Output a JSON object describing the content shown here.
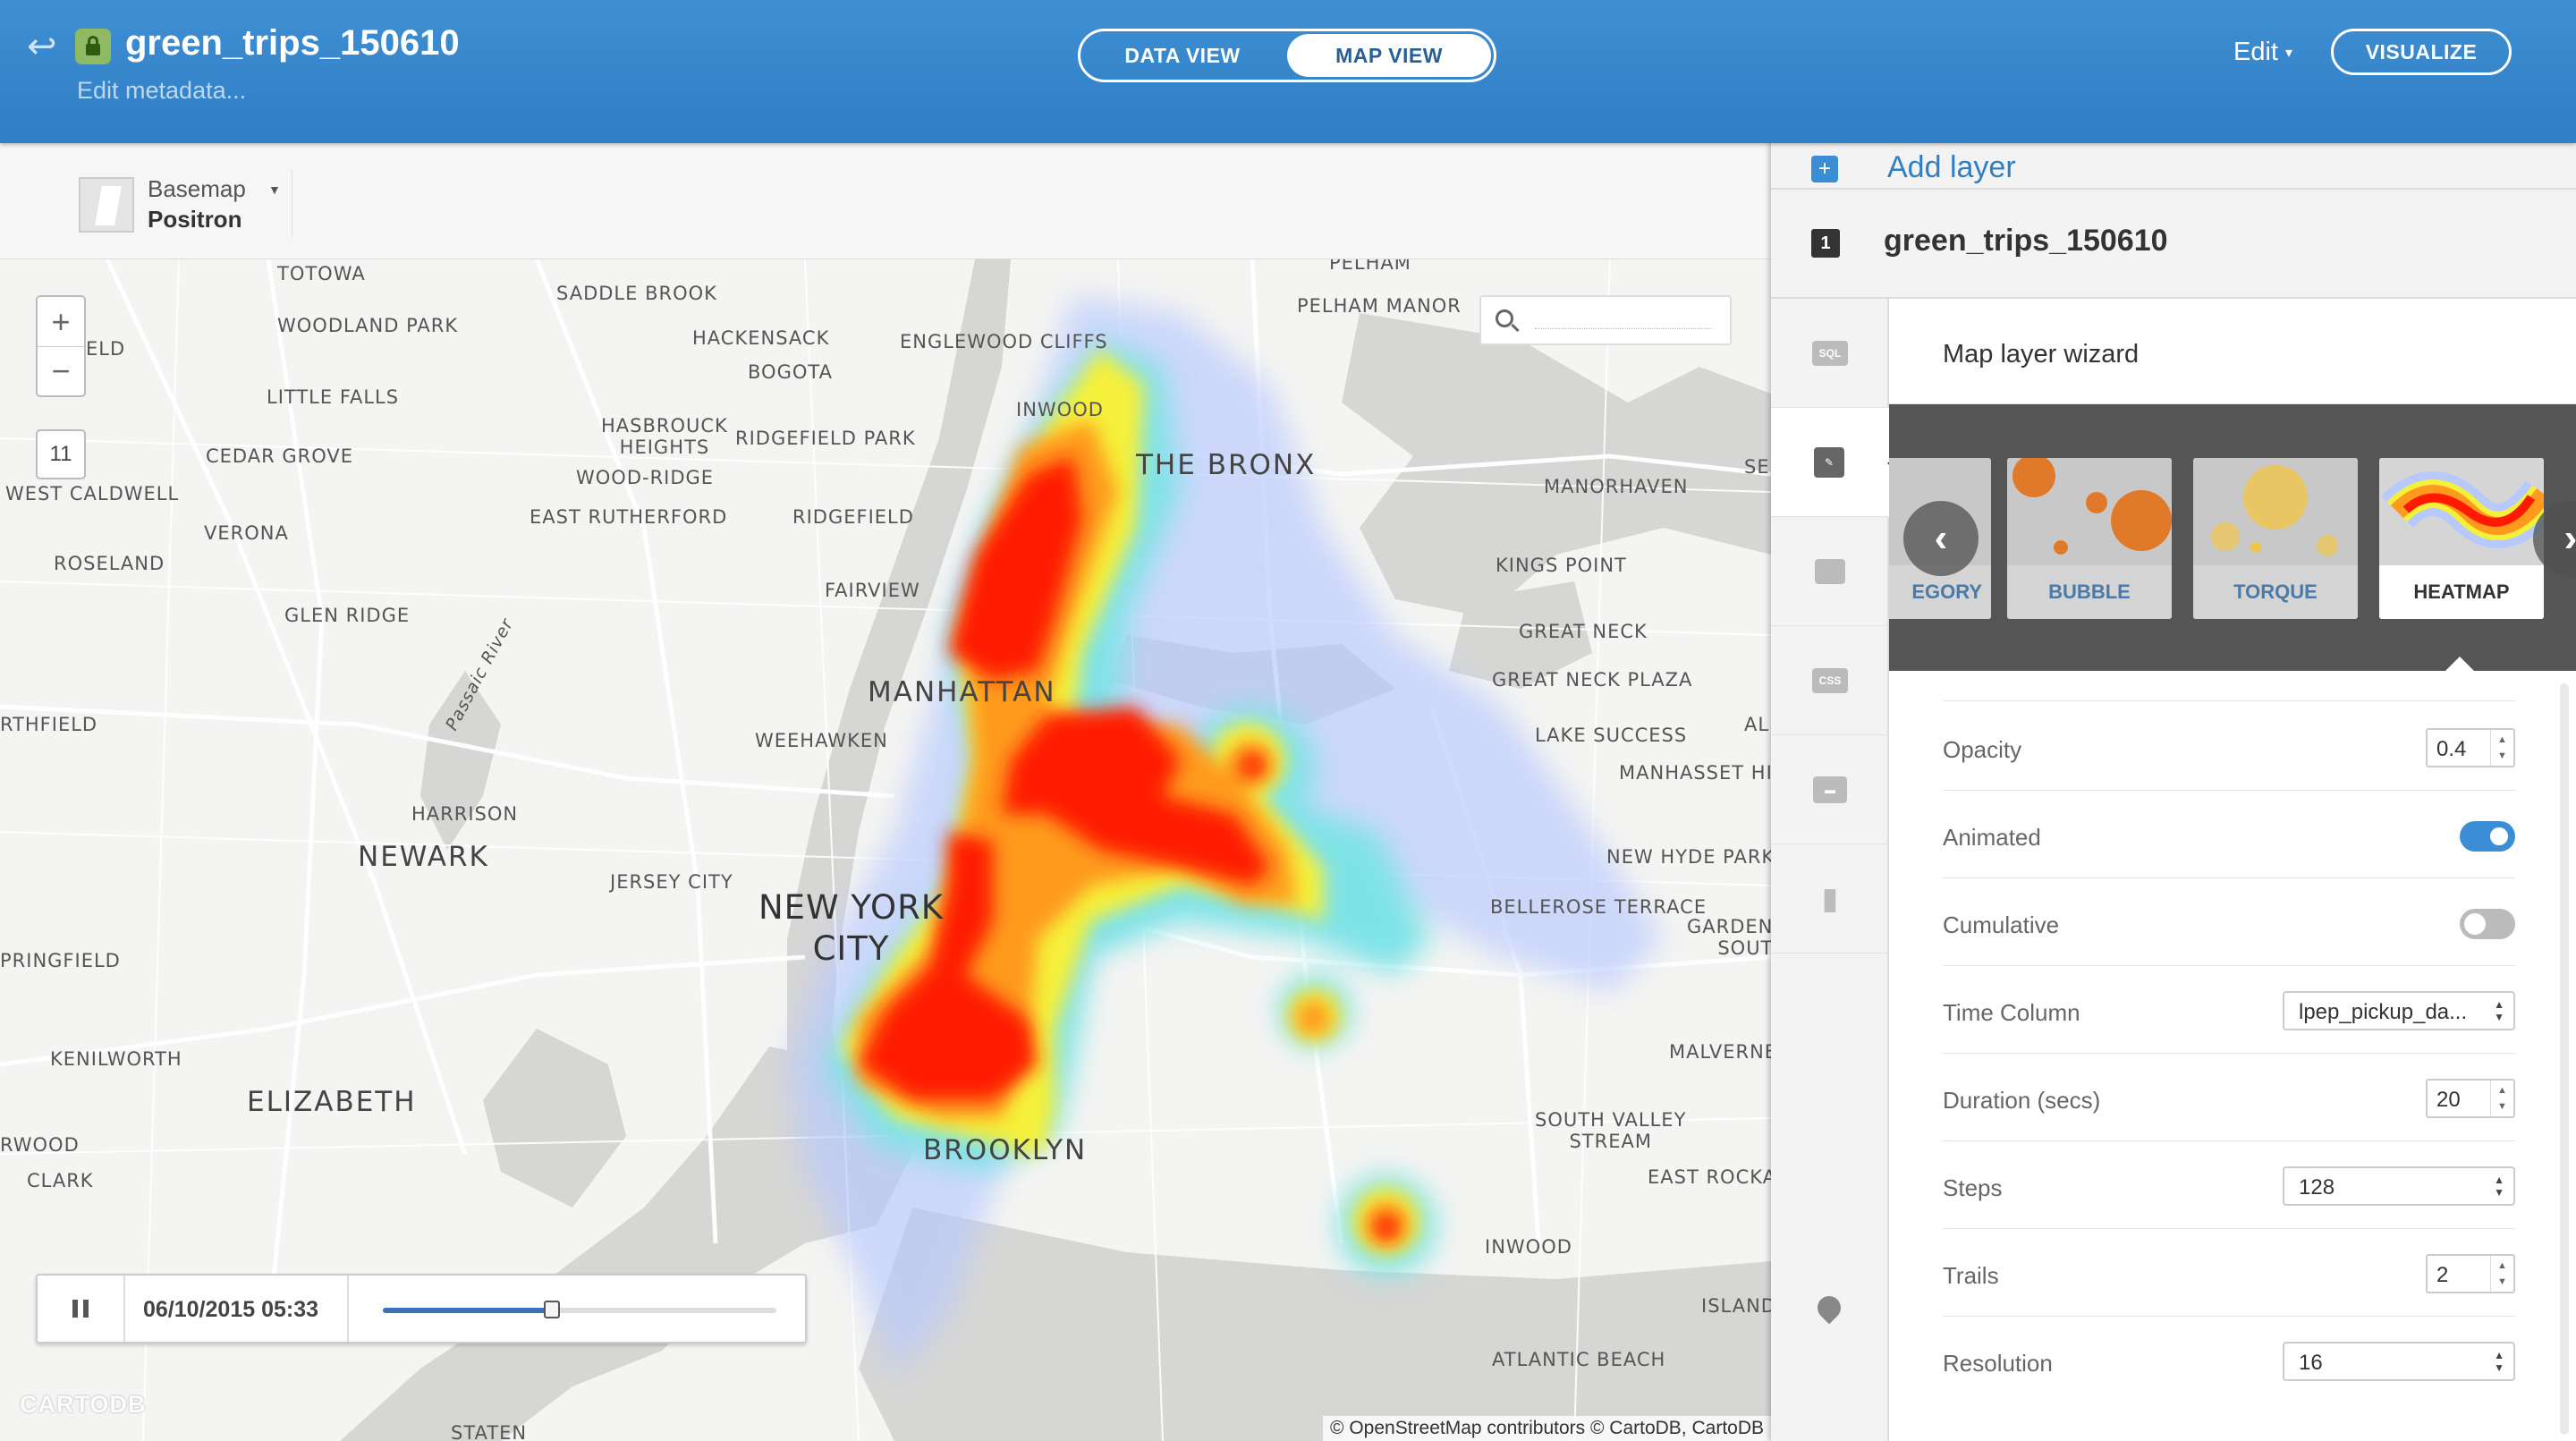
{
  "header": {
    "dataset_title": "green_trips_150610",
    "edit_metadata": "Edit metadata...",
    "tabs": [
      {
        "label": "DATA VIEW",
        "active": false
      },
      {
        "label": "MAP VIEW",
        "active": true
      }
    ],
    "edit_label": "Edit",
    "visualize_label": "VISUALIZE",
    "brand_color": "#3585cc"
  },
  "toolbar": {
    "basemap_label": "Basemap",
    "basemap_value": "Positron"
  },
  "map": {
    "zoom_in": "+",
    "zoom_out": "−",
    "zoom_level": "11",
    "search_placeholder": "",
    "attribution": "© OpenStreetMap contributors © CartoDB, CartoDB",
    "logo_text": "CARTODB",
    "places": {
      "totowa": "TOTOWA",
      "saddle_brook": "SADDLE BROOK",
      "woodland_park": "WOODLAND PARK",
      "hackensack": "HACKENSACK",
      "englewood_cliffs": "ENGLEWOOD CLIFFS",
      "pelham_manor": "PELHAM MANOR",
      "bogota": "BOGOTA",
      "inwood": "INWOOD",
      "little_falls": "LITTLE FALLS",
      "hasbrouck_heights": "HASBROUCK\nHEIGHTS",
      "ridgefield_park": "RIDGEFIELD PARK",
      "the_bronx": "THE BRONX",
      "cedar_grove": "CEDAR GROVE",
      "wood_ridge": "WOOD-RIDGE",
      "manorhaven": "MANORHAVEN",
      "west_caldwell": "WEST CALDWELL",
      "east_rutherford": "EAST RUTHERFORD",
      "ridgefield": "RIDGEFIELD",
      "verona": "VERONA",
      "roseland": "ROSELAND",
      "kings_point": "KINGS POINT",
      "fairview": "FAIRVIEW",
      "glen_ridge": "GLEN RIDGE",
      "great_neck": "GREAT NECK",
      "manhattan": "MANHATTAN",
      "great_neck_plaza": "GREAT NECK PLAZA",
      "northfield": "RTHFIELD",
      "weehawken": "WEEHAWKEN",
      "lake_success": "LAKE SUCCESS",
      "manhasset_hill": "MANHASSET HILL",
      "harrison": "HARRISON",
      "passaic_river": "Passaic River",
      "newark": "NEWARK",
      "new_hyde_park": "NEW HYDE PARK",
      "jersey_city": "JERSEY CITY",
      "new_york_city": "NEW YORK\nCITY",
      "bellerose_terrace": "BELLEROSE TERRACE",
      "garden_city_south": "GARDEN\nSOUT",
      "springfield": "PRINGFIELD",
      "kenilworth": "KENILWORTH",
      "malverne": "MALVERNE",
      "elizabeth": "ELIZABETH",
      "brooklyn": "BROOKLYN",
      "south_valley_stream": "SOUTH VALLEY\nSTREAM",
      "rahway": "RWOOD",
      "east_rockaway": "EAST ROCKAW",
      "clark": "CLARK",
      "inwood_li": "INWOOD",
      "island": "ISLAND",
      "atlantic_beach": "ATLANTIC BEACH",
      "staten": "STATEN",
      "pelham": "PELHAM",
      "ald": "ELD",
      "sea": "SE",
      "al": "AL"
    }
  },
  "timeline": {
    "datetime": "06/10/2015 05:33",
    "progress": 0.43
  },
  "panel": {
    "add_layer_label": "Add layer",
    "layer_index": "1",
    "layer_name": "green_trips_150610",
    "sidebar_tabs": [
      {
        "icon": "sql-icon",
        "label": "SQL"
      },
      {
        "icon": "wizard-brush-icon",
        "label": ""
      },
      {
        "icon": "infowindow-icon",
        "label": ""
      },
      {
        "icon": "css-icon",
        "label": "CSS"
      },
      {
        "icon": "legend-icon",
        "label": ""
      },
      {
        "icon": "filters-chart-icon",
        "label": ""
      }
    ],
    "wizard_title": "Map layer wizard",
    "viz_types": [
      {
        "label": "EGORY",
        "selected": false
      },
      {
        "label": "BUBBLE",
        "selected": false
      },
      {
        "label": "TORQUE",
        "selected": false
      },
      {
        "label": "HEATMAP",
        "selected": true
      }
    ],
    "settings": {
      "opacity": {
        "label": "Opacity",
        "value": "0.4"
      },
      "animated": {
        "label": "Animated",
        "on": true
      },
      "cumulative": {
        "label": "Cumulative",
        "on": false
      },
      "time_column": {
        "label": "Time Column",
        "value": "lpep_pickup_da..."
      },
      "duration": {
        "label": "Duration (secs)",
        "value": "20"
      },
      "steps": {
        "label": "Steps",
        "value": "128"
      },
      "trails": {
        "label": "Trails",
        "value": "2"
      },
      "resolution": {
        "label": "Resolution",
        "value": "16"
      }
    }
  }
}
